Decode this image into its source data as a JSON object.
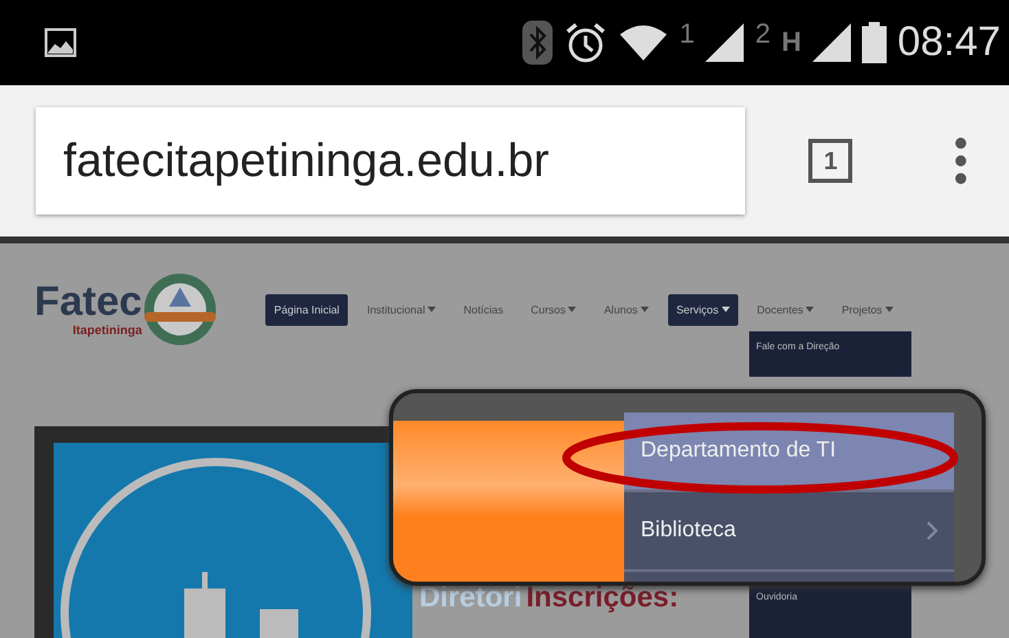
{
  "status_bar": {
    "sim_1": "1",
    "sim_2": "2",
    "network_type": "H",
    "time": "08:47"
  },
  "browser": {
    "url": "fatecitapetininga.edu.br",
    "tab_count": "1"
  },
  "site": {
    "logo": {
      "name": "Fatec",
      "city": "Itapetininga"
    },
    "nav": [
      {
        "label": "Página Inicial",
        "selected": true,
        "has_menu": false
      },
      {
        "label": "Institucional",
        "selected": false,
        "has_menu": true
      },
      {
        "label": "Notícias",
        "selected": false,
        "has_menu": false
      },
      {
        "label": "Cursos",
        "selected": false,
        "has_menu": true
      },
      {
        "label": "Alunos",
        "selected": false,
        "has_menu": true
      },
      {
        "label": "Serviços",
        "selected": true,
        "has_menu": true
      },
      {
        "label": "Docentes",
        "selected": false,
        "has_menu": true
      },
      {
        "label": "Projetos",
        "selected": false,
        "has_menu": true
      }
    ],
    "dropdown": [
      "Fale com a Direção",
      "Ouvidoria"
    ],
    "banner": {
      "heading_behind": "Diretori",
      "heading_front": "Inscrições:"
    }
  },
  "magnifier": {
    "items": [
      {
        "label": "Departamento de TI",
        "circled": true,
        "submenu": false
      },
      {
        "label": "Biblioteca",
        "circled": false,
        "submenu": true
      }
    ]
  }
}
